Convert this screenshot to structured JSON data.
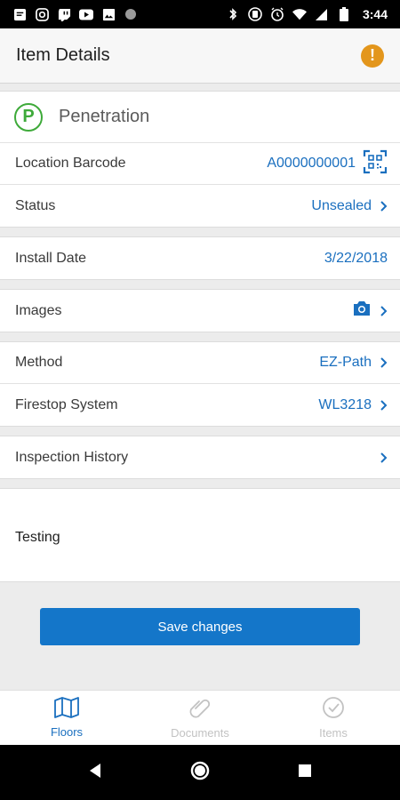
{
  "status_bar": {
    "time": "3:44"
  },
  "app_bar": {
    "title": "Item Details",
    "warning_symbol": "!"
  },
  "item": {
    "type_letter": "P",
    "type_name": "Penetration"
  },
  "fields": {
    "location_barcode": {
      "label": "Location Barcode",
      "value": "A0000000001"
    },
    "status": {
      "label": "Status",
      "value": "Unsealed"
    },
    "install_date": {
      "label": "Install Date",
      "value": "3/22/2018"
    },
    "images": {
      "label": "Images"
    },
    "method": {
      "label": "Method",
      "value": "EZ-Path"
    },
    "firestop_system": {
      "label": "Firestop System",
      "value": "WL3218"
    },
    "inspection_history": {
      "label": "Inspection History"
    }
  },
  "notes": {
    "text": "Testing"
  },
  "save_button": {
    "label": "Save changes"
  },
  "bottom_nav": {
    "floors": "Floors",
    "documents": "Documents",
    "items": "Items"
  },
  "colors": {
    "accent": "#1a6fbf",
    "button": "#1476c9",
    "warning": "#e3961c",
    "type_badge": "#3eaa3a"
  }
}
